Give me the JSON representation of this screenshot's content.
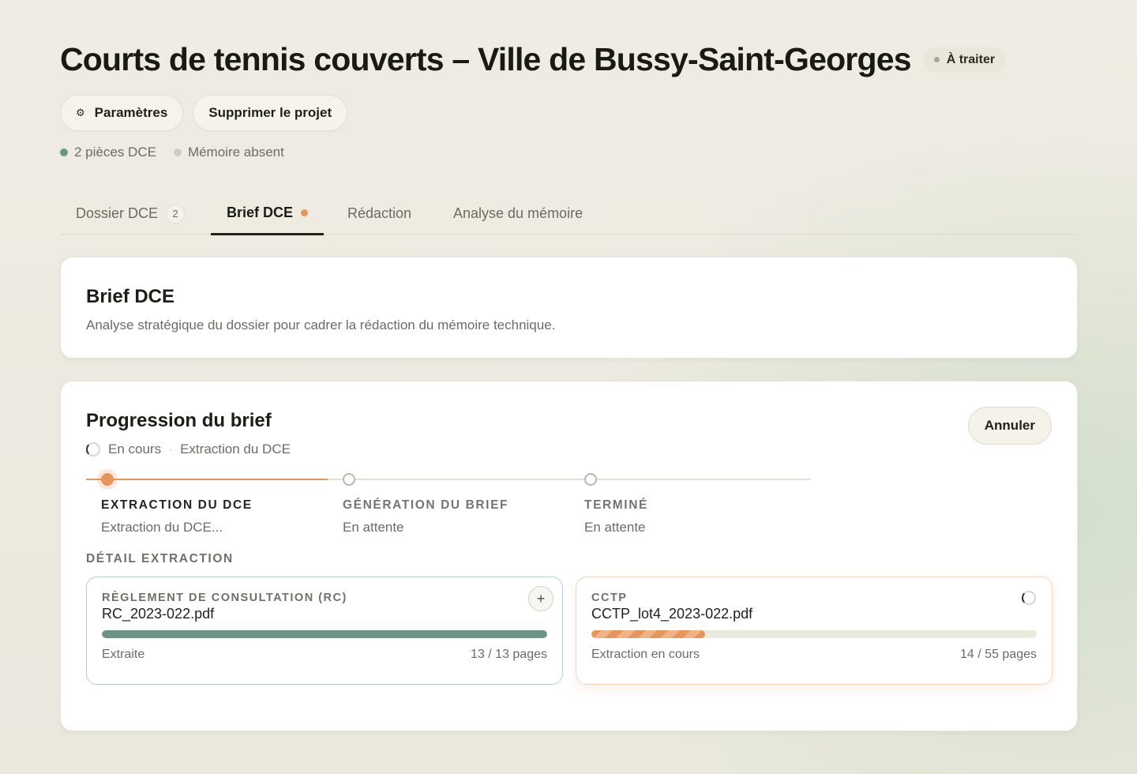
{
  "project": {
    "title": "Courts de tennis couverts – Ville de Bussy-Saint-Georges",
    "status": "À traiter"
  },
  "actions": {
    "settings_label": "Paramètres",
    "settings_icon": "gear-icon",
    "delete_label": "Supprimer le projet"
  },
  "meta": {
    "pieces": "2 pièces DCE",
    "memoire": "Mémoire absent",
    "pieces_color": "#6c9484",
    "memoire_color": "#cdccc3"
  },
  "tabs": [
    {
      "label": "Dossier DCE",
      "badge": "2"
    },
    {
      "label": "Brief DCE",
      "active": true,
      "indicator_color": "#e8955a"
    },
    {
      "label": "Rédaction"
    },
    {
      "label": "Analyse du mémoire"
    }
  ],
  "brief": {
    "title": "Brief DCE",
    "description": "Analyse stratégique du dossier pour cadrer la rédaction du mémoire technique."
  },
  "progress": {
    "title": "Progression du brief",
    "state": "En cours",
    "separator": "·",
    "current_step_text": "Extraction du DCE",
    "cancel_label": "Annuler",
    "steps": [
      {
        "label": "EXTRACTION DU DCE",
        "description": "Extraction du DCE...",
        "status": "current"
      },
      {
        "label": "GÉNÉRATION DU BRIEF",
        "description": "En attente",
        "status": "pending"
      },
      {
        "label": "TERMINÉ",
        "description": "En attente",
        "status": "pending"
      }
    ],
    "detail_title": "DÉTAIL EXTRACTION",
    "files": [
      {
        "type": "RÈGLEMENT DE CONSULTATION (RC)",
        "name": "RC_2023-022.pdf",
        "status": "Extraite",
        "pages": "13 / 13 pages",
        "progress": 1.0,
        "icon": "plus-icon"
      },
      {
        "type": "CCTP",
        "name": "CCTP_lot4_2023-022.pdf",
        "status": "Extraction en cours",
        "pages": "14 / 55 pages",
        "progress": 0.2545,
        "icon": "spinner-icon"
      }
    ]
  },
  "colors": {
    "accent": "#e8955a",
    "success": "#6c9484"
  }
}
